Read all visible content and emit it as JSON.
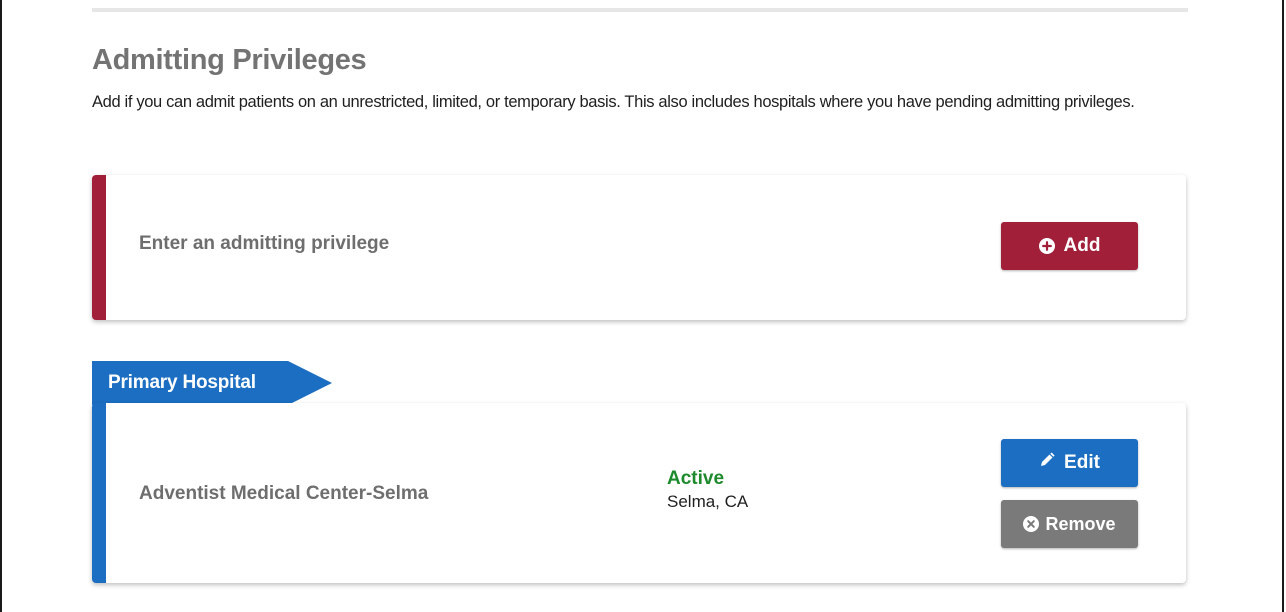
{
  "section": {
    "title": "Admitting Privileges",
    "description": "Add if you can admit patients on an unrestricted, limited, or temporary basis. This also includes hospitals where you have pending admitting privileges."
  },
  "add_card": {
    "prompt": "Enter an admitting privilege",
    "add_label": "Add",
    "add_icon": "plus-circle-icon",
    "accent_color": "#a21f3a"
  },
  "hospital_card": {
    "ribbon_label": "Primary Hospital",
    "name": "Adventist Medical Center-Selma",
    "status": "Active",
    "location": "Selma, CA",
    "edit_label": "Edit",
    "edit_icon": "pencil-icon",
    "remove_label": "Remove",
    "remove_icon": "x-circle-icon",
    "accent_color": "#1b6ec2",
    "status_color": "#1e8a2e",
    "remove_color": "#7a7a7a"
  }
}
